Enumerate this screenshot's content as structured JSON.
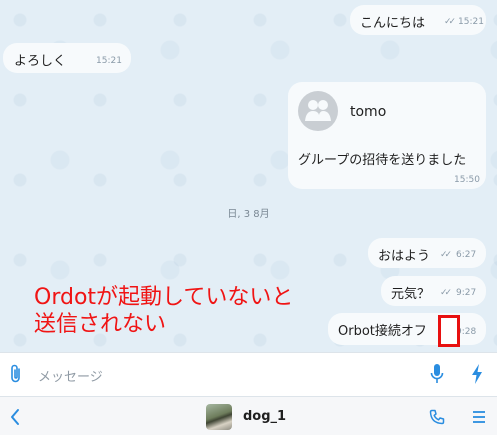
{
  "messages": [
    {
      "text": "こんにちは",
      "time": "15:21"
    },
    {
      "text": "よろしく",
      "time": "15:21"
    },
    {
      "contact_name": "tomo",
      "text": "グループの招待を送りました",
      "time": "15:50"
    },
    {
      "text": "おはよう",
      "time": "6:27"
    },
    {
      "text": "元気？",
      "time": "9:27"
    },
    {
      "text": "Orbot接続オフ",
      "time": "9:28"
    }
  ],
  "date_separator": "日, 3 8月",
  "annotation": {
    "line1": "Ordotが起動していないと",
    "line2": "送信されない",
    "color": "#f01414"
  },
  "input": {
    "placeholder": "メッセージ"
  },
  "nav": {
    "contact_name": "dog_1"
  },
  "colors": {
    "accent": "#2a8de0",
    "chat_background": "#e3eef6"
  },
  "icons": [
    "attach-icon",
    "mic-icon",
    "bolt-icon",
    "back-icon",
    "phone-icon",
    "menu-icon",
    "read-check-icon"
  ]
}
